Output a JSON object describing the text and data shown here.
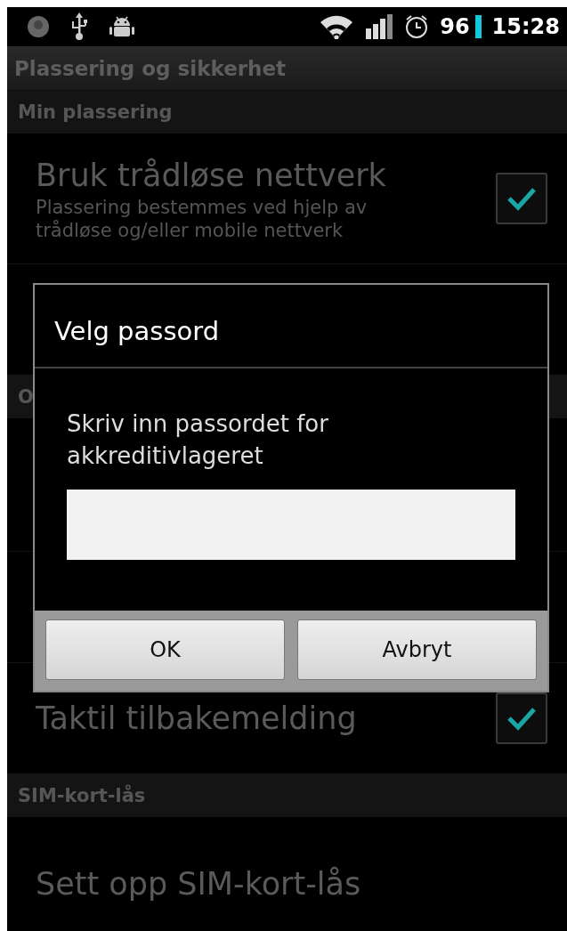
{
  "status_bar": {
    "battery": "96",
    "time": "15:28"
  },
  "title_bar": {
    "title": "Plassering og sikkerhet"
  },
  "sections": [
    {
      "kind": "category",
      "title": "Min plassering"
    },
    {
      "kind": "checkbox",
      "title": "Bruk trådløse nettverk",
      "summary": "Plassering bestemmes ved hjelp av trådløse og/eller mobile nettverk",
      "checked": true
    },
    {
      "kind": "blank"
    },
    {
      "kind": "category",
      "title": "O"
    },
    {
      "kind": "plain"
    },
    {
      "kind": "blank"
    },
    {
      "kind": "checkbox",
      "title": "Taktil tilbakemelding",
      "checked": true
    },
    {
      "kind": "category",
      "title": "SIM-kort-lås"
    },
    {
      "kind": "plain",
      "title": "Sett opp SIM-kort-lås"
    }
  ],
  "dialog": {
    "title": "Velg passord",
    "message": "Skriv inn passordet for akkreditivlageret",
    "buttons": [
      "OK",
      "Avbryt"
    ]
  }
}
